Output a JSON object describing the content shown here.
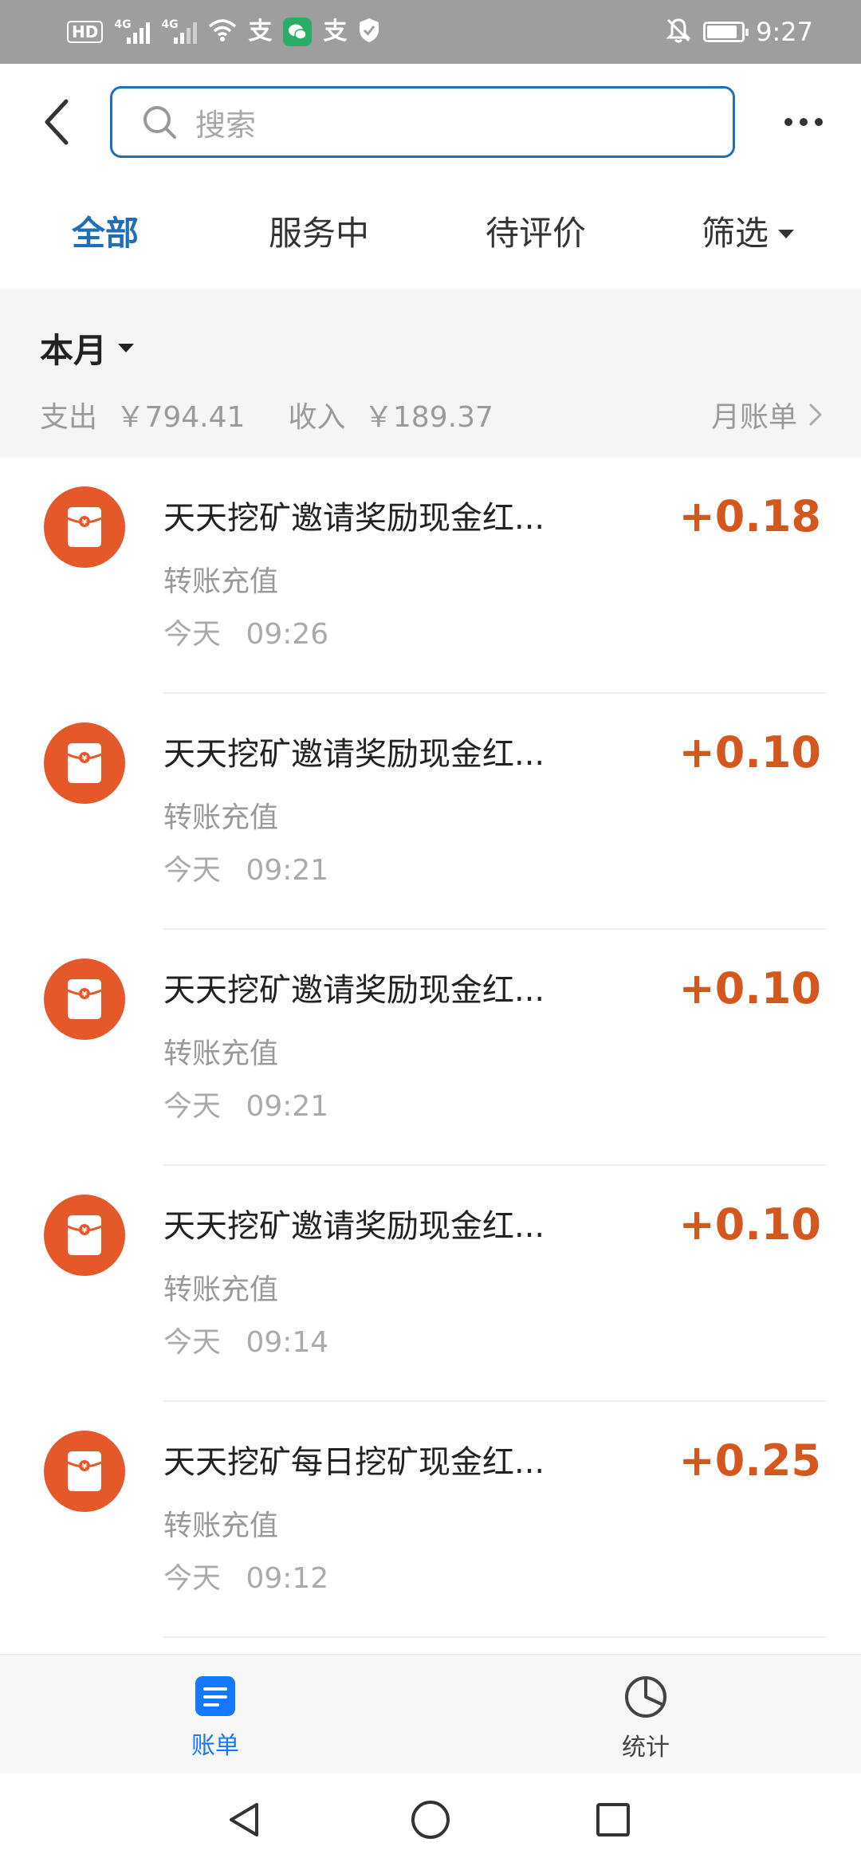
{
  "status_bar": {
    "hd_label": "HD",
    "net1": "4G",
    "net2": "4G",
    "alipay1": "支",
    "alipay2": "支",
    "time": "9:27"
  },
  "header": {
    "search_placeholder": "搜索"
  },
  "tabs": [
    {
      "label": "全部",
      "active": true
    },
    {
      "label": "服务中",
      "active": false
    },
    {
      "label": "待评价",
      "active": false
    },
    {
      "label": "筛选",
      "active": false
    }
  ],
  "month": {
    "title": "本月",
    "expense_label": "支出",
    "expense_value": "￥794.41",
    "income_label": "收入",
    "income_value": "￥189.37",
    "bill_label": "月账单"
  },
  "transactions": [
    {
      "title": "天天挖矿邀请奖励现金红...",
      "type": "转账充值",
      "date": "今天",
      "time": "09:26",
      "amount": "+0.18"
    },
    {
      "title": "天天挖矿邀请奖励现金红...",
      "type": "转账充值",
      "date": "今天",
      "time": "09:21",
      "amount": "+0.10"
    },
    {
      "title": "天天挖矿邀请奖励现金红...",
      "type": "转账充值",
      "date": "今天",
      "time": "09:21",
      "amount": "+0.10"
    },
    {
      "title": "天天挖矿邀请奖励现金红...",
      "type": "转账充值",
      "date": "今天",
      "time": "09:14",
      "amount": "+0.10"
    },
    {
      "title": "天天挖矿每日挖矿现金红...",
      "type": "转账充值",
      "date": "今天",
      "time": "09:12",
      "amount": "+0.25"
    }
  ],
  "bottom_tabs": [
    {
      "label": "账单",
      "icon": "bill-icon",
      "active": true
    },
    {
      "label": "统计",
      "icon": "pie-chart-icon",
      "active": false
    }
  ],
  "colors": {
    "accent": "#1f6fb8",
    "amount": "#d4581e",
    "red_packet": "#e5582a",
    "tab_active": "#1677ff"
  }
}
